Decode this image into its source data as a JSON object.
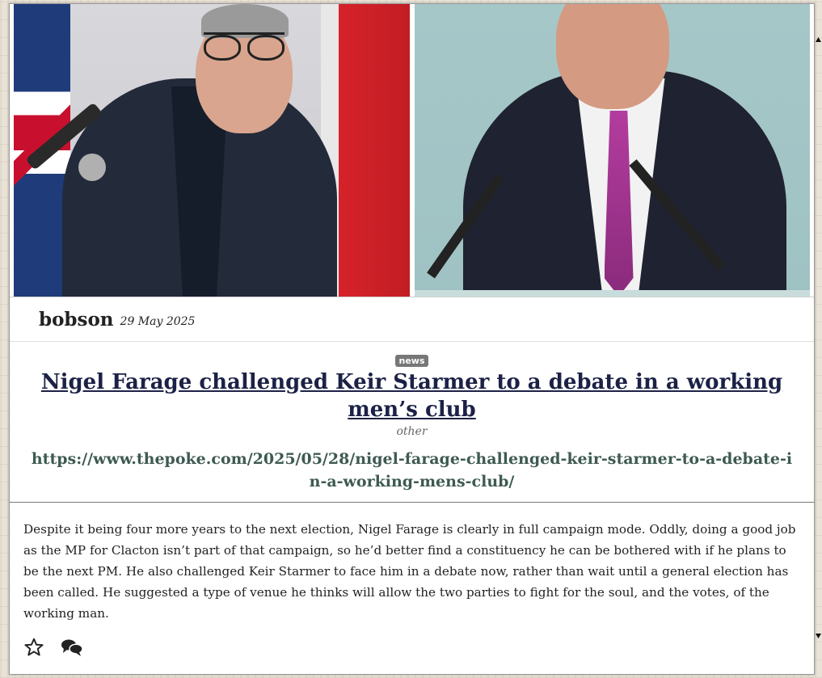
{
  "post": {
    "author": "bobson",
    "date": "29 May 2025",
    "badge": "news",
    "title": "Nigel Farage challenged Keir Starmer to a debate in a working men’s club",
    "category": "other",
    "url": "https://www.thepoke.com/2025/05/28/nigel-farage-challenged-keir-starmer-to-a-debate-in-a-working-mens-club/",
    "body": "Despite it being four more years to the next election, Nigel Farage is clearly in full campaign mode. Oddly, doing a good job as the MP for Clacton isn’t part of that campaign, so he’d better find a constituency he can be bothered with if he plans to be the next PM. He also challenged Keir Starmer to face him in a debate now, rather than wait until a general election has been called. He suggested a type of venue he thinks will allow the two parties to fight for the soul, and the votes, of the working man."
  },
  "actions": {
    "favourite_icon": "star-icon",
    "comments_icon": "comments-icon"
  },
  "colors": {
    "title": "#1c2146",
    "url": "#3e5a52",
    "badge": "#777777"
  }
}
